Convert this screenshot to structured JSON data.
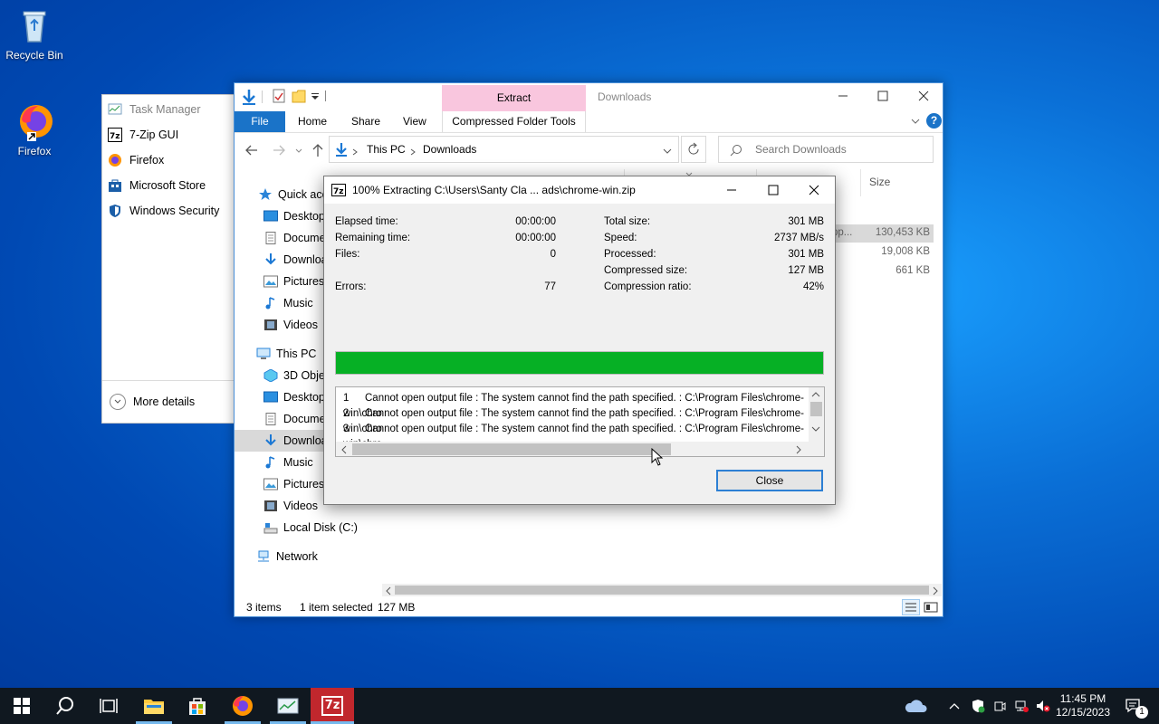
{
  "desktop": {
    "icons": [
      {
        "label": "Recycle Bin",
        "icon": "recycle-bin-icon"
      },
      {
        "label": "Firefox",
        "icon": "firefox-icon"
      }
    ]
  },
  "task_manager": {
    "title": "Task Manager",
    "items": [
      {
        "label": "7-Zip GUI",
        "icon": "7zip-icon"
      },
      {
        "label": "Firefox",
        "icon": "firefox-icon"
      },
      {
        "label": "Microsoft Store",
        "icon": "store-icon"
      },
      {
        "label": "Windows Security",
        "icon": "shield-icon"
      }
    ],
    "more_details": "More details"
  },
  "explorer": {
    "title": "Downloads",
    "contextual_tab": "Extract",
    "tabs": [
      "File",
      "Home",
      "Share",
      "View",
      "Compressed Folder Tools"
    ],
    "breadcrumb": [
      "This PC",
      "Downloads"
    ],
    "search_placeholder": "Search Downloads",
    "column_size": "Size",
    "partial_text": "pp...",
    "file_sizes": [
      "130,453 KB",
      "19,008 KB",
      "661 KB"
    ],
    "nav": {
      "quick_access": "Quick access",
      "quick_items": [
        "Desktop",
        "Documents",
        "Downloads",
        "Pictures",
        "Music",
        "Videos"
      ],
      "this_pc": "This PC",
      "pc_items": [
        "3D Objects",
        "Desktop",
        "Documents",
        "Downloads",
        "Music",
        "Pictures",
        "Videos",
        "Local Disk (C:)"
      ],
      "network": "Network"
    },
    "status": {
      "items": "3 items",
      "selected": "1 item selected",
      "size": "127 MB"
    }
  },
  "zip_dialog": {
    "title": "100% Extracting C:\\Users\\Santy Cla ... ads\\chrome-win.zip",
    "left_stats": [
      {
        "label": "Elapsed time:",
        "value": "00:00:00"
      },
      {
        "label": "Remaining time:",
        "value": "00:00:00"
      },
      {
        "label": "Files:",
        "value": "0"
      },
      {
        "label": "Errors:",
        "value": "77"
      }
    ],
    "right_stats": [
      {
        "label": "Total size:",
        "value": "301 MB"
      },
      {
        "label": "Speed:",
        "value": "2737 MB/s"
      },
      {
        "label": "Processed:",
        "value": "301 MB"
      },
      {
        "label": "Compressed size:",
        "value": "127 MB"
      },
      {
        "label": "Compression ratio:",
        "value": "42%"
      }
    ],
    "progress": 100,
    "progress_color": "#06b025",
    "errors": [
      {
        "num": "1",
        "text": "Cannot open output file : The system cannot find the path specified. : C:\\Program Files\\chrome-win\\chro"
      },
      {
        "num": "2",
        "text": "Cannot open output file : The system cannot find the path specified. : C:\\Program Files\\chrome-win\\chro"
      },
      {
        "num": "3",
        "text": "Cannot open output file : The system cannot find the path specified. : C:\\Program Files\\chrome-win\\chro"
      }
    ],
    "close_label": "Close"
  },
  "taskbar": {
    "time": "11:45 PM",
    "date": "12/15/2023",
    "notification_count": "1",
    "zip_label": "7z"
  },
  "colors": {
    "accent": "#0063b1",
    "extract_tab": "#f9c6de"
  }
}
